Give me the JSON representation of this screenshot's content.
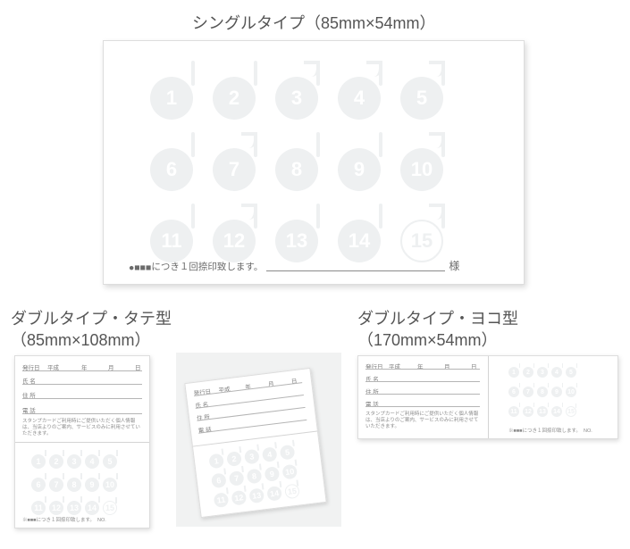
{
  "headings": {
    "single": "シングルタイプ（85mm×54mm）",
    "double_v_line1": "ダブルタイプ・タテ型",
    "double_v_line2": "（85mm×108mm）",
    "double_h_line1": "ダブルタイプ・ヨコ型",
    "double_h_line2": "（170mm×54mm）"
  },
  "stamps": {
    "n1": "1",
    "n2": "2",
    "n3": "3",
    "n4": "4",
    "n5": "5",
    "n6": "6",
    "n7": "7",
    "n8": "8",
    "n9": "9",
    "n10": "10",
    "n11": "11",
    "n12": "12",
    "n13": "13",
    "n14": "14",
    "n15": "15"
  },
  "card": {
    "stamp_note_prefix": "●■■■",
    "stamp_note_text": "につき１回捺印致します。",
    "sama": "様",
    "issue_label": "発行日",
    "era": "平成",
    "year_unit": "年",
    "month_unit": "月",
    "day_unit": "日",
    "name_label": "氏 名",
    "address_label": "住 所",
    "phone_label": "電 話",
    "privacy": "スタンプカードご利用時にご提供いただく個人情報は、当店よりのご案内、サービスのみに利用させていただきます。",
    "bottom_note": "※■■■につき１回捺印致します。",
    "no_label": "NO."
  }
}
